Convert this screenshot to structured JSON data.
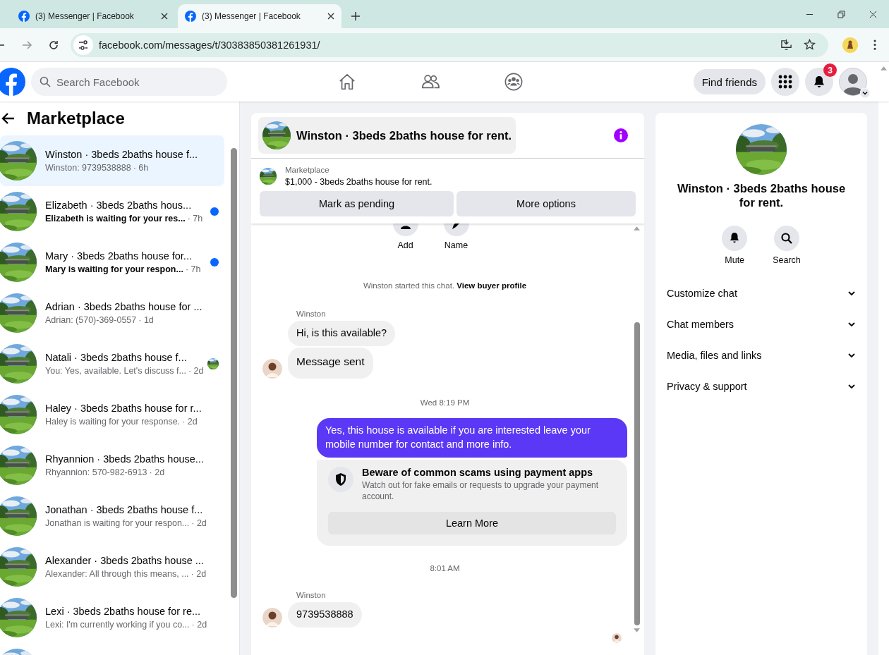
{
  "browser": {
    "tabs": [
      {
        "title": "(3) Messenger | Facebook",
        "selected": false
      },
      {
        "title": "(3) Messenger | Facebook",
        "selected": true
      }
    ],
    "url": "facebook.com/messages/t/30383850381261931/"
  },
  "header": {
    "search_placeholder": "Search Facebook",
    "nav": [
      {
        "kind": "home"
      },
      {
        "kind": "friends"
      },
      {
        "kind": "groups"
      }
    ],
    "find_friends": "Find friends",
    "notification_count": "3"
  },
  "sidebar": {
    "title": "Marketplace",
    "conversations": [
      {
        "title": "Winston · 3beds 2baths house f...",
        "preview": "Winston: 9739538888",
        "time": "· 6h",
        "selected": true,
        "unread": false,
        "seen": false
      },
      {
        "title": "Elizabeth · 3beds 2baths hous...",
        "preview": "Elizabeth is waiting for your res...",
        "time": "· 7h",
        "selected": false,
        "unread": true,
        "seen": false
      },
      {
        "title": "Mary · 3beds 2baths house for...",
        "preview": "Mary is waiting for your respon...",
        "time": "· 7h",
        "selected": false,
        "unread": true,
        "seen": false
      },
      {
        "title": "Adrian · 3beds 2baths house for ...",
        "preview": "Adrian: (570)-369-0557",
        "time": "· 1d",
        "selected": false,
        "unread": false,
        "seen": false
      },
      {
        "title": "Natali · 3beds 2baths house f...",
        "preview": "You: Yes, available. Let's discuss f...",
        "time": "· 2d",
        "selected": false,
        "unread": false,
        "seen": true
      },
      {
        "title": "Haley · 3beds 2baths house for r...",
        "preview": "Haley is waiting for your response.",
        "time": "· 2d",
        "selected": false,
        "unread": false,
        "seen": false
      },
      {
        "title": "Rhyannion · 3beds 2baths house...",
        "preview": "Rhyannion: 570-982-6913",
        "time": "· 2d",
        "selected": false,
        "unread": false,
        "seen": false
      },
      {
        "title": "Jonathan · 3beds 2baths house f...",
        "preview": "Jonathan is waiting for your respon...",
        "time": "· 2d",
        "selected": false,
        "unread": false,
        "seen": false
      },
      {
        "title": "Alexander · 3beds 2baths house ...",
        "preview": "Alexander: All through this means, ...",
        "time": "· 2d",
        "selected": false,
        "unread": false,
        "seen": false
      },
      {
        "title": "Lexi · 3beds 2baths house for re...",
        "preview": "Lexi: I'm currently working if you co...",
        "time": "· 2d",
        "selected": false,
        "unread": false,
        "seen": false
      }
    ]
  },
  "chat": {
    "title": "Winston · 3beds 2baths house for rent.",
    "listing": {
      "source": "Marketplace",
      "summary": "$1,000 - 3beds 2baths house for rent."
    },
    "actions": [
      "Mark as pending",
      "More options"
    ],
    "quick_actions": [
      {
        "kind": "add",
        "label": "Add"
      },
      {
        "kind": "name",
        "label": "Name"
      }
    ],
    "started_note": {
      "text": "Winston started this chat.",
      "link": "View buyer profile"
    },
    "messages": [
      {
        "kind": "sender",
        "text": "Winston"
      },
      {
        "kind": "incoming",
        "text": "Hi, is this available?",
        "avatar": false
      },
      {
        "kind": "status",
        "text": "Message sent",
        "avatar": true
      },
      {
        "kind": "time",
        "text": "Wed 8:19 PM"
      },
      {
        "kind": "outgoing",
        "text": "Yes, this house is available if you are interested leave your mobile number for contact and more info."
      },
      {
        "kind": "notice",
        "title": "Beware of common scams using payment apps",
        "body": "Watch out for fake emails or requests to upgrade your payment account.",
        "button": "Learn More"
      },
      {
        "kind": "time",
        "text": "8:01 AM"
      },
      {
        "kind": "sender",
        "text": "Winston"
      },
      {
        "kind": "incoming",
        "text": "9739538888",
        "avatar": true
      },
      {
        "kind": "seen"
      }
    ]
  },
  "details": {
    "title": "Winston · 3beds 2baths house for rent.",
    "actions": [
      {
        "kind": "mute",
        "label": "Mute"
      },
      {
        "kind": "search",
        "label": "Search"
      }
    ],
    "sections": [
      {
        "label": "Customize chat",
        "expanded": false
      },
      {
        "label": "Chat members",
        "expanded": false
      },
      {
        "label": "Media, files and links",
        "expanded": false
      },
      {
        "label": "Privacy & support",
        "expanded": false
      }
    ]
  }
}
